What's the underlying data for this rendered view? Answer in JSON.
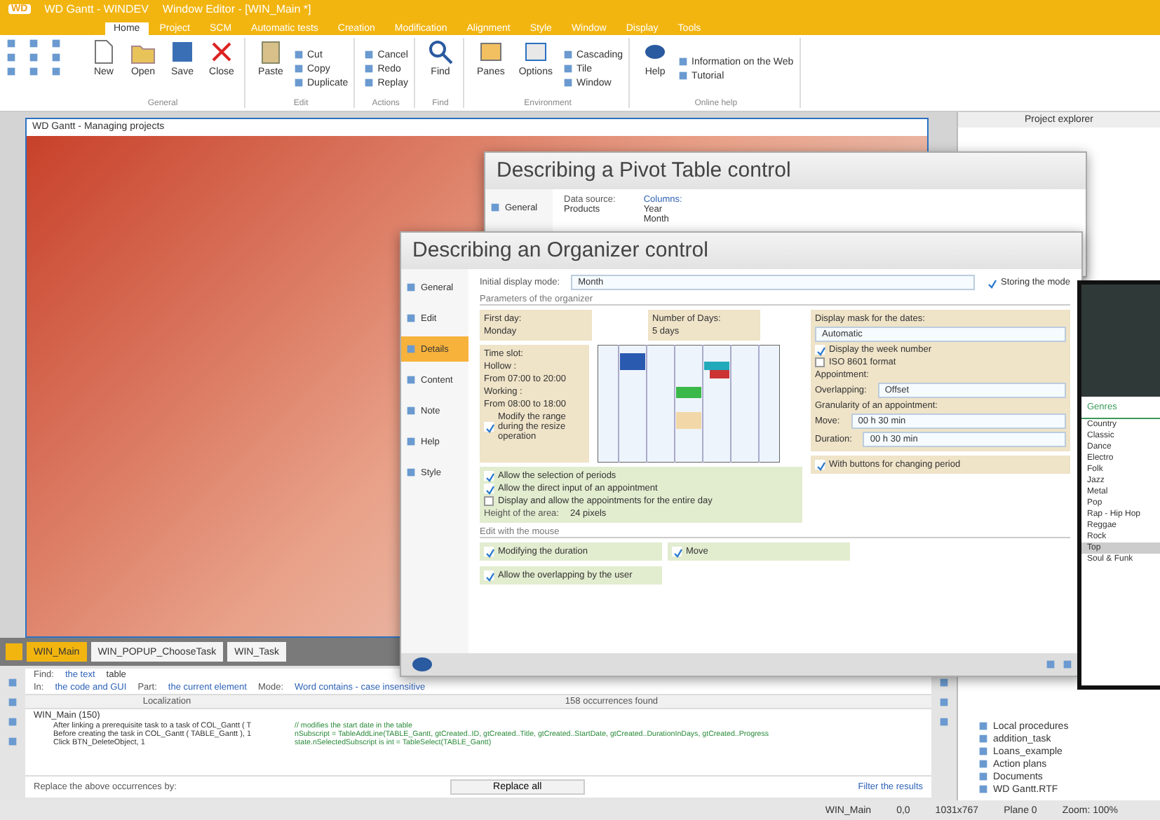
{
  "app_window": {
    "logo": "WD",
    "title": "WD Gantt - WINDEV",
    "editor_title": "Window Editor - [WIN_Main *]"
  },
  "ribbon_tabs": [
    {
      "label": "Home",
      "selected": true
    },
    {
      "label": "Project",
      "selected": false
    },
    {
      "label": "SCM",
      "selected": false
    },
    {
      "label": "Automatic tests",
      "selected": false
    },
    {
      "label": "Creation",
      "selected": false
    },
    {
      "label": "Modification",
      "selected": false
    },
    {
      "label": "Alignment",
      "selected": false
    },
    {
      "label": "Style",
      "selected": false
    },
    {
      "label": "Window",
      "selected": false
    },
    {
      "label": "Display",
      "selected": false
    },
    {
      "label": "Tools",
      "selected": false
    }
  ],
  "ribbon_groups": [
    {
      "title": "General",
      "large": [
        {
          "label": "New",
          "kind": "file"
        },
        {
          "label": "Open",
          "kind": "folder"
        },
        {
          "label": "Save",
          "kind": "save"
        },
        {
          "label": "Close",
          "kind": "close"
        }
      ]
    },
    {
      "title": "Edit",
      "large": [
        {
          "label": "Paste",
          "kind": "paste"
        }
      ],
      "small": [
        "Cut",
        "Copy",
        "Duplicate"
      ]
    },
    {
      "title": "Actions",
      "small": [
        "Cancel",
        "Redo",
        "Replay"
      ]
    },
    {
      "title": "Find",
      "large": [
        {
          "label": "Find",
          "kind": "search"
        }
      ]
    },
    {
      "title": "Environment",
      "large": [
        {
          "label": "Panes",
          "kind": "panes"
        },
        {
          "label": "Options",
          "kind": "options"
        }
      ],
      "small": [
        "Cascading",
        "Tile",
        "Window"
      ]
    },
    {
      "title": "Online help",
      "large": [
        {
          "label": "Help",
          "kind": "help"
        }
      ],
      "small": [
        "Information on the Web",
        "Tutorial"
      ]
    }
  ],
  "edited_window": {
    "title": "WD Gantt - Managing projects"
  },
  "doc_tabs": [
    {
      "label": "WIN_Main",
      "selected": true
    },
    {
      "label": "WIN_POPUP_ChooseTask",
      "selected": false
    },
    {
      "label": "WIN_Task",
      "selected": false
    }
  ],
  "find_panel": {
    "find_label": "Find:",
    "find_mode": "the text",
    "find_value": "table",
    "in_label": "In:",
    "in_value": "the code and GUI",
    "part_label": "Part:",
    "part_value": "the current element",
    "mode_label": "Mode:",
    "mode_value": "Word contains - case insensitive",
    "col_localization": "Localization",
    "col_count": "158 occurrences found",
    "group": "WIN_Main (150)",
    "results": [
      {
        "location": "After linking a prerequisite task to a task of COL_Gantt ( T",
        "code": "// modifies the start date in the table"
      },
      {
        "location": "Before creating the task in COL_Gantt ( TABLE_Gantt ), 1",
        "code": "nSubscript = TableAddLine(TABLE_Gantt, gtCreated..ID, gtCreated..Title, gtCreated..StartDate, gtCreated..DurationInDays, gtCreated..Progress"
      },
      {
        "location": "Click BTN_DeleteObject, 1",
        "code": "state.nSelectedSubscript is int = TableSelect(TABLE_Gantt)"
      }
    ],
    "replace_label": "Replace the above occurrences by:",
    "replace_button": "Replace all",
    "filter_button": "Filter the results"
  },
  "project_explorer": {
    "title": "Project explorer",
    "tree": [
      "Local procedures",
      "addition_task",
      "Loans_example",
      "Action plans",
      "Documents",
      "WD Gantt.RTF"
    ]
  },
  "status_bar": [
    "WIN_Main",
    "0,0",
    "1031x767",
    "Plane 0",
    "Zoom: 100%"
  ],
  "pivot_dialog": {
    "title": "Describing a Pivot Table control",
    "nav": "General",
    "source_label": "Data source:",
    "source_value": "Products",
    "columns_label": "Columns:",
    "columns": [
      "Year",
      "Month"
    ]
  },
  "organizer_dialog": {
    "title": "Describing an Organizer control",
    "nav": [
      {
        "label": "General",
        "selected": false
      },
      {
        "label": "Edit",
        "selected": false
      },
      {
        "label": "Details",
        "selected": true
      },
      {
        "label": "Content",
        "selected": false
      },
      {
        "label": "Note",
        "selected": false
      },
      {
        "label": "Help",
        "selected": false
      },
      {
        "label": "Style",
        "selected": false
      }
    ],
    "display_mode_label": "Initial display mode:",
    "display_mode": "Month",
    "storing_mode": {
      "label": "Storing the mode",
      "checked": true
    },
    "parameters_title": "Parameters of the organizer",
    "first_day": {
      "label": "First day:",
      "value": "Monday"
    },
    "days": {
      "label": "Number of Days:",
      "value": "5 days"
    },
    "time_slot": {
      "title": "Time slot:",
      "lines": [
        "Hollow :",
        "From 07:00 to 20:00",
        "Working :",
        "From 08:00 to 18:00"
      ],
      "modify": {
        "label": "Modify the range during the resize operation",
        "checked": true
      }
    },
    "mask": {
      "label": "Display mask for the dates:",
      "value": "Automatic",
      "week": {
        "label": "Display the week number",
        "checked": true
      },
      "iso": {
        "label": "ISO 8601 format",
        "checked": false
      }
    },
    "appointment": {
      "title": "Appointment:",
      "overlap_label": "Overlapping:",
      "overlap_value": "Offset",
      "granularity": "Granularity of an appointment:",
      "move_label": "Move:",
      "move_value": "00 h 30 min",
      "duration_label": "Duration:",
      "duration_value": "00 h 30 min"
    },
    "period_buttons": {
      "label": "With buttons for changing period",
      "checked": true
    },
    "options": [
      {
        "label": "Allow the selection of periods",
        "checked": true
      },
      {
        "label": "Allow the direct input of an appointment",
        "checked": true
      },
      {
        "label": "Display and allow the appointments for the entire day",
        "checked": false
      }
    ],
    "height": {
      "label": "Height of the area:",
      "value": "24 pixels"
    },
    "mouse_title": "Edit with the mouse",
    "mouse_options": [
      {
        "label": "Modifying the duration",
        "checked": true
      },
      {
        "label": "Move",
        "checked": true
      },
      {
        "label": "Allow the overlapping by the user",
        "checked": true
      }
    ]
  },
  "phone_app": {
    "section": "Genres",
    "genres": [
      {
        "label": "Country",
        "selected": false
      },
      {
        "label": "Classic",
        "selected": false
      },
      {
        "label": "Dance",
        "selected": false
      },
      {
        "label": "Electro",
        "selected": false
      },
      {
        "label": "Folk",
        "selected": false
      },
      {
        "label": "Jazz",
        "selected": false
      },
      {
        "label": "Metal",
        "selected": false
      },
      {
        "label": "Pop",
        "selected": false
      },
      {
        "label": "Rap - Hip Hop",
        "selected": false
      },
      {
        "label": "Reggae",
        "selected": false
      },
      {
        "label": "Rock",
        "selected": false
      },
      {
        "label": "Top",
        "selected": true
      },
      {
        "label": "Soul & Funk",
        "selected": false
      }
    ]
  }
}
